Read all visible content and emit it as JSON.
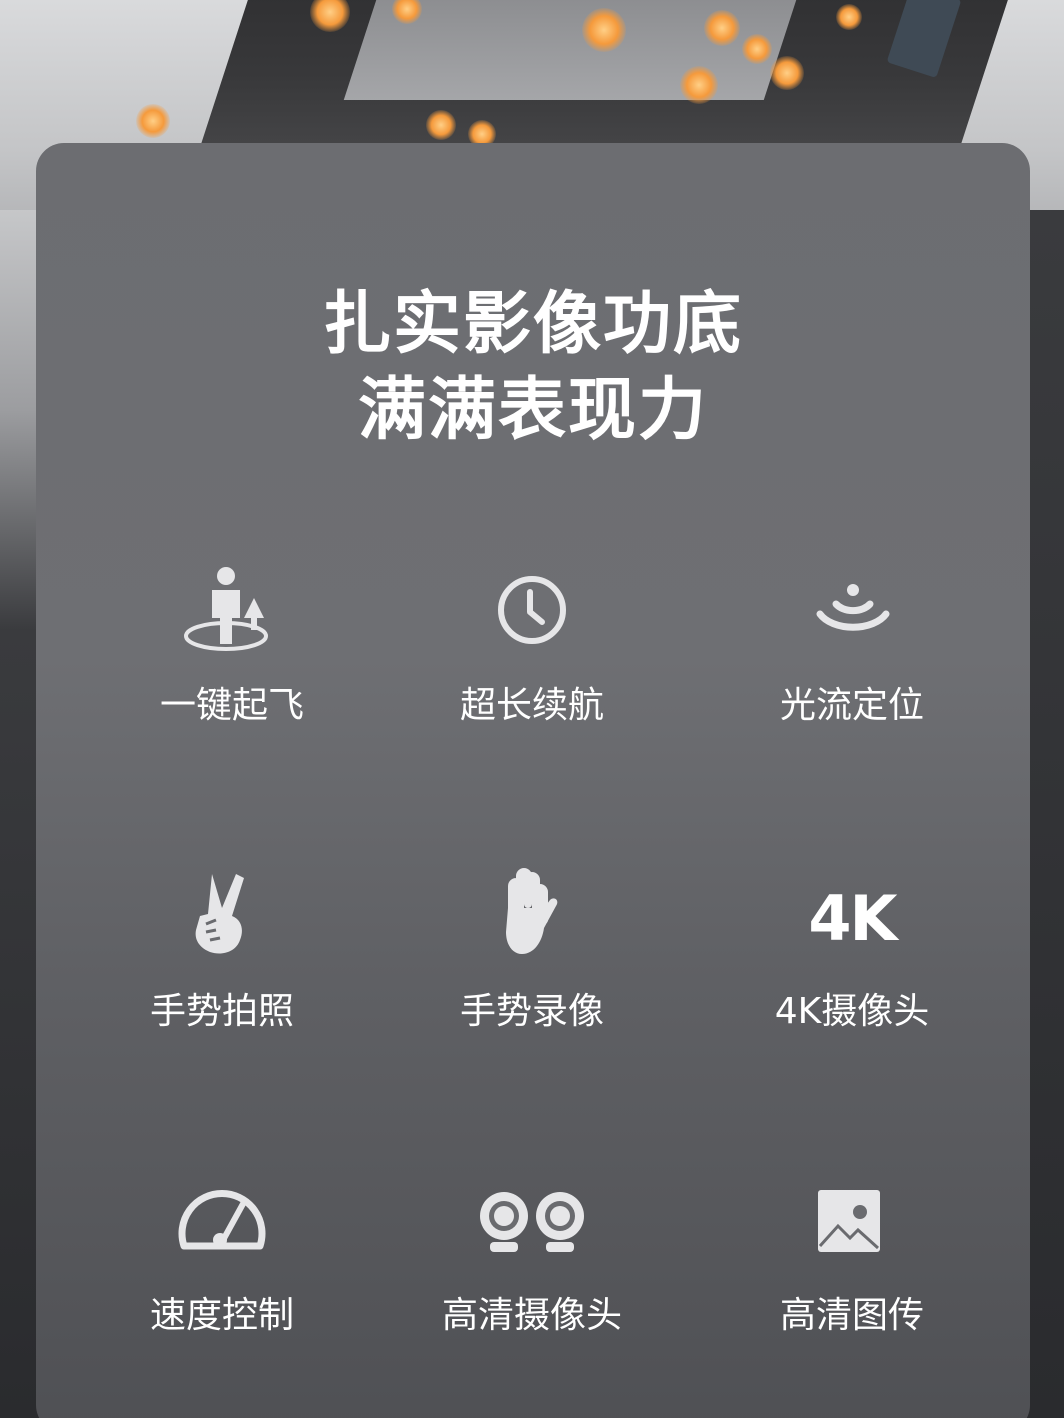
{
  "headline": {
    "line1": "扎实影像功底",
    "line2": "满满表现力"
  },
  "features": [
    {
      "label": "一键起飞",
      "icon": "one-key-takeoff-icon"
    },
    {
      "label": "超长续航",
      "icon": "clock-icon"
    },
    {
      "label": "光流定位",
      "icon": "optical-flow-icon"
    },
    {
      "label": "手势拍照",
      "icon": "victory-hand-icon"
    },
    {
      "label": "手势录像",
      "icon": "open-palm-icon"
    },
    {
      "label": "4K摄像头",
      "icon": "4k-icon",
      "badge": "4K"
    },
    {
      "label": "速度控制",
      "icon": "speedometer-icon"
    },
    {
      "label": "高清摄像头",
      "icon": "dual-camera-icon"
    },
    {
      "label": "高清图传",
      "icon": "image-icon"
    }
  ],
  "colors": {
    "card": "#6c6d71",
    "text": "#ffffff",
    "icon": "#e6e6e8"
  }
}
